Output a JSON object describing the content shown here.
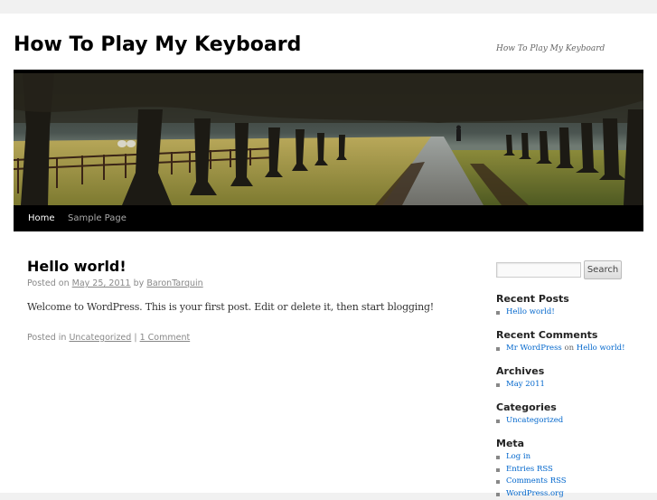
{
  "site": {
    "title": "How To Play My Keyboard",
    "description": "How To Play My Keyboard"
  },
  "header_image": {
    "icon": "header-photo-tree-lined-avenue",
    "alt": "Tree-lined avenue with fence and path"
  },
  "nav": {
    "items": [
      {
        "label": "Home",
        "current": true
      },
      {
        "label": "Sample Page",
        "current": false
      }
    ]
  },
  "post": {
    "title": "Hello world!",
    "meta_prefix": "Posted on",
    "date": "May 25, 2011",
    "by": "by",
    "author": "BaronTarquin",
    "content": "Welcome to WordPress. This is your first post. Edit or delete it, then start blogging!",
    "utility_prefix": "Posted in",
    "category": "Uncategorized",
    "separator": "|",
    "comments": "1 Comment"
  },
  "sidebar": {
    "search": {
      "placeholder": "",
      "value": "",
      "button_label": "Search"
    },
    "recent_posts": {
      "title": "Recent Posts",
      "items": [
        "Hello world!"
      ]
    },
    "recent_comments": {
      "title": "Recent Comments",
      "items": [
        {
          "author": "Mr WordPress",
          "on": "on",
          "post": "Hello world!"
        }
      ]
    },
    "archives": {
      "title": "Archives",
      "items": [
        "May 2011"
      ]
    },
    "categories": {
      "title": "Categories",
      "items": [
        "Uncategorized"
      ]
    },
    "meta": {
      "title": "Meta",
      "items": [
        "Log in",
        "Entries RSS",
        "Comments RSS",
        "WordPress.org"
      ]
    }
  },
  "colors": {
    "link": "#0066cc",
    "nav_bg": "#000000",
    "page_bg": "#f1f1f1"
  }
}
